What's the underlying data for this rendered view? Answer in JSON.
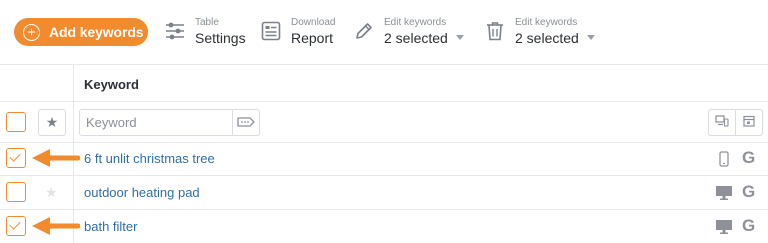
{
  "toolbar": {
    "add_label": "Add keywords",
    "table_small": "Table",
    "table_big": "Settings",
    "download_small": "Download",
    "download_big": "Report",
    "edit1_small": "Edit keywords",
    "edit1_big": "2 selected",
    "edit2_small": "Edit keywords",
    "edit2_big": "2 selected"
  },
  "table": {
    "column_header": "Keyword",
    "filter_placeholder": "Keyword",
    "rows": [
      {
        "keyword": "6 ft unlit christmas tree",
        "checked": true,
        "device_icon": "mobile-icon",
        "engine": "G"
      },
      {
        "keyword": "outdoor heating pad",
        "checked": false,
        "device_icon": "desktop-icon",
        "engine": "G"
      },
      {
        "keyword": "bath filter",
        "checked": true,
        "device_icon": "desktop-icon",
        "engine": "G"
      }
    ]
  },
  "colors": {
    "accent": "#f28a2e",
    "link": "#2f6fa8",
    "border": "#e6e8eb"
  }
}
